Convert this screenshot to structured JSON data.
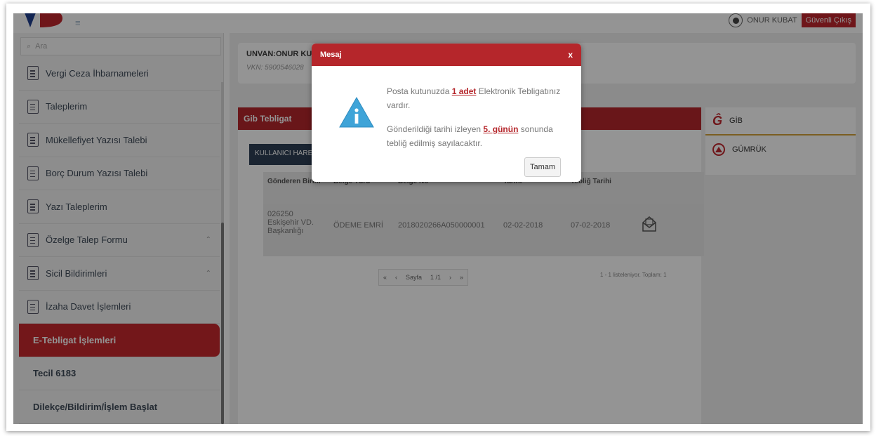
{
  "header": {
    "user_name": "ONUR KUBAT",
    "logout_label": "Güvenli Çıkış"
  },
  "sidebar": {
    "search_placeholder": "Ara",
    "items": [
      {
        "label": "Vergi Ceza İhbarnameleri"
      },
      {
        "label": "Taleplerim"
      },
      {
        "label": "Mükellefiyet Yazısı Talebi"
      },
      {
        "label": "Borç Durum Yazısı Talebi"
      },
      {
        "label": "Yazı Taleplerim"
      },
      {
        "label": "Özelge Talep Formu",
        "caret": "⌃"
      },
      {
        "label": "Sicil Bildirimleri",
        "caret": "⌃"
      },
      {
        "label": "İzaha Davet İşlemleri"
      },
      {
        "label": "E-Tebligat İşlemleri"
      },
      {
        "label": "Tecil 6183"
      },
      {
        "label": "Dilekçe/Bildirim/İşlem Başlat"
      }
    ]
  },
  "info": {
    "title": "UNVAN:ONUR KUBA",
    "vkn": "VKN: 5900546028"
  },
  "gib_panel": {
    "header": "Gib Tebligat",
    "user_actions": "KULLANICI HARE",
    "columns": [
      "Gönderen Birim",
      "Belge Türü",
      "Belge No",
      "Tarihi",
      "Tebliğ Tarihi"
    ],
    "rows": [
      {
        "sender_code": "026250",
        "sender_name": "Eskişehir VD.",
        "sender_unit": "Başkanlığı",
        "doc_type": "ÖDEME EMRİ",
        "doc_no": "2018020266A050000001",
        "date": "02-02-2018",
        "notify_date": "07-02-2018"
      }
    ],
    "pager": {
      "first": "«",
      "prev": "‹",
      "page_label": "Sayfa",
      "page_value": "1 /1",
      "next": "›",
      "last": "»",
      "summary": "1 - 1 listeleniyor. Toplam: 1"
    }
  },
  "right_panel": {
    "gib_label": "GİB",
    "gumruk_label": "GÜMRÜK"
  },
  "modal": {
    "title": "Mesaj",
    "close": "x",
    "line1_pre": "Posta kutunuzda ",
    "line1_link": "1 adet",
    "line1_post": " Elektronik Tebligatınız vardır.",
    "line2_pre": "Gönderildiği tarihi izleyen ",
    "line2_link": "5. günün",
    "line2_post": " sonunda tebliğ edilmiş sayılacaktır.",
    "ok_label": "Tamam"
  },
  "colors": {
    "brand_red": "#b5262b",
    "navy": "#2e3f55",
    "info_blue": "#3fa4d8"
  }
}
